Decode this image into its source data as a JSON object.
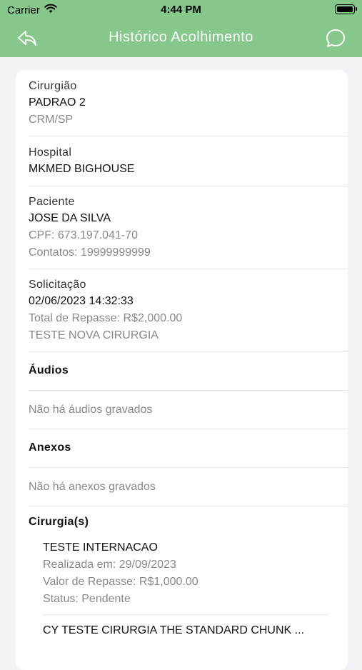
{
  "status_bar": {
    "carrier": "Carrier",
    "time": "4:44 PM"
  },
  "nav": {
    "title": "Histórico Acolhimento",
    "back_icon": "back-arrow-icon",
    "chat_icon": "chat-bubble-icon"
  },
  "surgeon": {
    "label": "Cirurgião",
    "name": "PADRAO 2",
    "crm": "CRM/SP"
  },
  "hospital": {
    "label": "Hospital",
    "name": "MKMED BIGHOUSE"
  },
  "patient": {
    "label": "Paciente",
    "name": "JOSE DA SILVA",
    "cpf": "CPF: 673.197.041-70",
    "contacts": "Contatos:  19999999999"
  },
  "request": {
    "label": "Solicitação",
    "datetime": "02/06/2023 14:32:33",
    "total": "Total de Repasse: R$2,000.00",
    "description": "TESTE NOVA CIRURGIA"
  },
  "audios": {
    "label": "Áudios",
    "empty": "Não há áudios gravados"
  },
  "attachments": {
    "label": "Anexos",
    "empty": "Não há anexos gravados"
  },
  "surgeries": {
    "label": "Cirurgia(s)",
    "items": [
      {
        "name": "TESTE INTERNACAO",
        "performed": "Realizada em: 29/09/2023",
        "value": "Valor de Repasse: R$1,000.00",
        "status": "Status: Pendente"
      },
      {
        "name": "CY TESTE CIRURGIA THE STANDARD CHUNK ..."
      }
    ]
  },
  "colors": {
    "header": "#86c78c",
    "background": "#f2f2f7",
    "card": "#ffffff"
  }
}
